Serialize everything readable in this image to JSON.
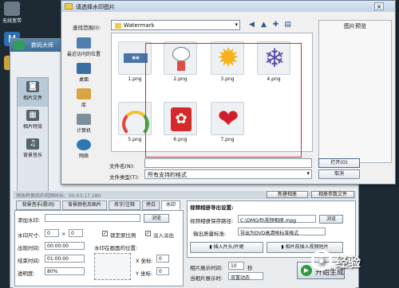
{
  "desktop": {
    "icons": [
      {
        "label": "无线宽带",
        "icon": "broadband-icon"
      }
    ]
  },
  "bg_app": {
    "title": "数码大师",
    "side": [
      {
        "label": "相片文件"
      },
      {
        "label": "相片特效"
      },
      {
        "label": "背景音乐"
      }
    ]
  },
  "dialog": {
    "title": "请选择水印图片",
    "lookin_label": "查找范围(I):",
    "lookin_value": "Watermark",
    "places": [
      "最近访问的位置",
      "桌面",
      "库",
      "计算机",
      "网络"
    ],
    "files": [
      "1.png",
      "2.png",
      "3.png",
      "4.png",
      "5.png",
      "6.png",
      "7.png"
    ],
    "preview_label": "图片预览",
    "filename_label": "文件名(N):",
    "filename_value": "",
    "filetype_label": "文件类型(T):",
    "filetype_value": "所有支持的格式",
    "open_label": "打开(O)",
    "cancel_label": "取消"
  },
  "bottom": {
    "status": "预估转换后的视频时长：00:03:17.280",
    "top_right_1": "新建相册",
    "top_right_2": "相册参数文件",
    "tabs": [
      "背景音乐(歌词)",
      "背景颜色及图片",
      "名字/注释",
      "旁白",
      "水印"
    ],
    "wm_add_label": "添加水印:",
    "browse_label": "浏览",
    "wm_size_label": "水印尺寸:",
    "size_w": "0",
    "size_sep": "×",
    "size_h": "0",
    "lock_ratio_label": "锁定原比例",
    "fade_label": "淡入淡出",
    "show_time_label": "出现时间:",
    "show_time_value": "00:00:00",
    "pos_label": "水印在画面的位置:",
    "end_time_label": "结束时间:",
    "end_time_value": "01:00:00",
    "x_label": "X 坐标:",
    "x_value": "0",
    "opacity_label": "透明度:",
    "opacity_value": "80%",
    "y_label": "Y 坐标:",
    "y_value": "0",
    "export_title": "视频相册导出设置:",
    "save_path_label": "视频相册保存路径:",
    "save_path_value": "C:\\DMGift\\视频相册.mpg",
    "browse2_label": "浏览",
    "quality_label": "输出质量标准:",
    "quality_value": "导出为DVD高清晰标准格式",
    "insert_head_label": "插入片头/片尾",
    "insert_mv_label": "相片前插入视频短片",
    "dur_label": "相片展示时间:",
    "dur_value": "10",
    "dur_unit": "秒",
    "anim_label": "当相片展示时:",
    "anim_value": "双重动态",
    "gen_label": "开始生成"
  },
  "watermark_text": "经验"
}
